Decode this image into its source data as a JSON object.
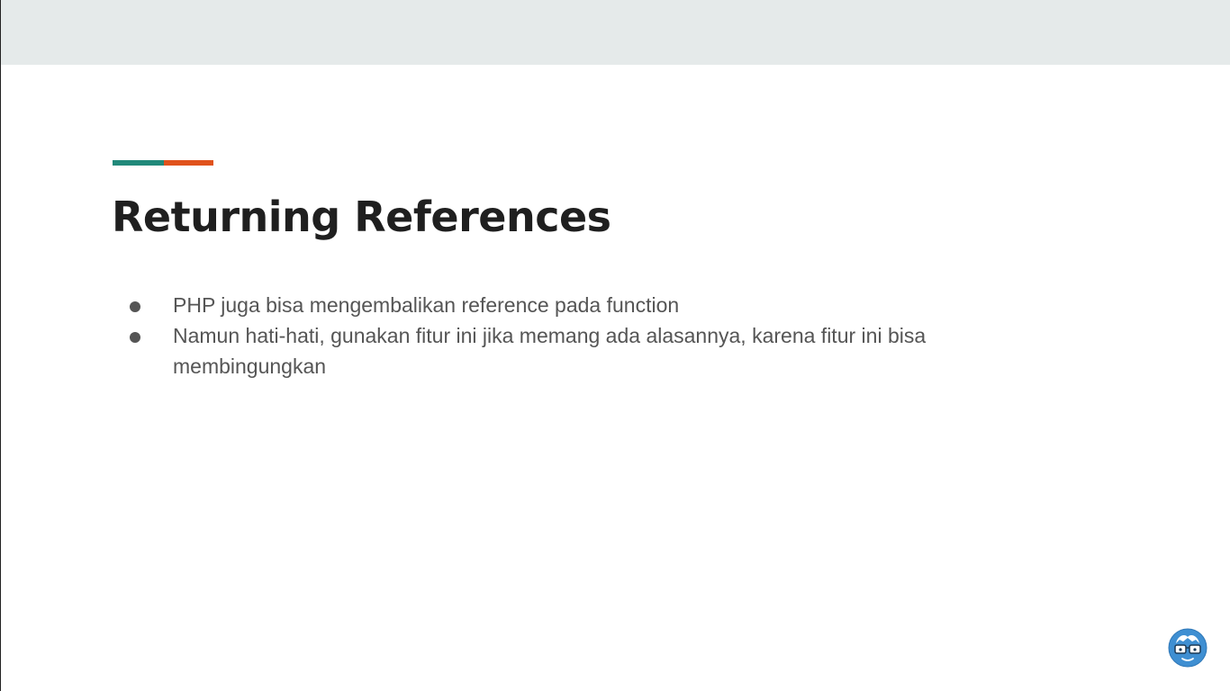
{
  "slide": {
    "title": "Returning References",
    "bullets": [
      "PHP juga bisa mengembalikan reference pada function",
      "Namun hati-hati, gunakan fitur ini jika memang ada alasannya, karena fitur ini bisa membingungkan"
    ]
  },
  "colors": {
    "accent_teal": "#21897a",
    "accent_orange": "#e0521c",
    "header_band": "#e5eaea",
    "logo_blue": "#3f8fd2"
  },
  "icons": {
    "logo": "glasses-face-logo-icon"
  }
}
